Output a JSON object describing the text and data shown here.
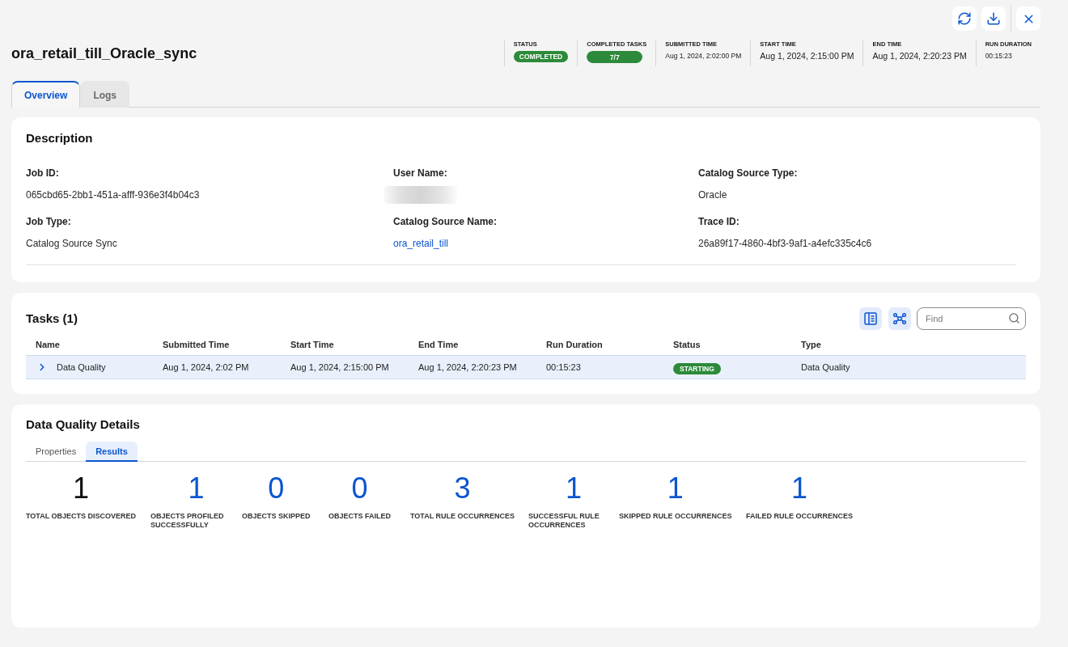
{
  "title": "ora_retail_till_Oracle_sync",
  "summary": [
    {
      "label": "STATUS",
      "kind": "badge",
      "value": "COMPLETED"
    },
    {
      "label": "COMPLETED TASKS",
      "kind": "progress",
      "value": "7/7",
      "level": 1
    },
    {
      "label": "SUBMITTED TIME",
      "kind": "text",
      "value": "Aug 1, 2024, 2:02:00 PM"
    },
    {
      "label": "START TIME",
      "kind": "text",
      "value": "Aug 1, 2024, 2:15:00 PM"
    },
    {
      "label": "END TIME",
      "kind": "text",
      "value": "Aug 1, 2024, 2:20:23 PM"
    },
    {
      "label": "RUN DURATION",
      "kind": "text",
      "value": "00:15:23"
    }
  ],
  "tabs": [
    {
      "label": "Overview",
      "selected": true
    },
    {
      "label": "Logs",
      "selected": false
    }
  ],
  "description": {
    "title": "Description",
    "fields": [
      {
        "label": "Job ID:",
        "kind": "text",
        "value": "065cbd65-2bb1-451a-afff-936e3f4b04c3"
      },
      {
        "label": "User Name:",
        "kind": "redacted"
      },
      {
        "label": "Catalog Source Type:",
        "kind": "text",
        "value": "Oracle"
      },
      {
        "label": "Job Type:",
        "kind": "text",
        "value": "Catalog Source Sync"
      },
      {
        "label": "Catalog Source Name:",
        "kind": "link",
        "value": "ora_retail_till"
      },
      {
        "label": "Trace ID:",
        "kind": "text",
        "value": "26a89f17-4860-4bf3-9af1-a4efc335c4c6"
      }
    ]
  },
  "tasks": {
    "title": "Tasks (1)",
    "search": {
      "placeholder": "Find"
    },
    "columns": [
      "Name",
      "Submitted Time",
      "Start Time",
      "End Time",
      "Run Duration",
      "Status",
      "Type"
    ],
    "rows": [
      {
        "selected": true,
        "expanded": false,
        "name": "Data Quality",
        "submitted_time": "Aug 1, 2024, 2:02 PM",
        "start_time": "Aug 1, 2024, 2:15:00 PM",
        "end_time": "Aug 1, 2024, 2:20:23 PM",
        "run_duration": "00:15:23",
        "status": "STARTING",
        "type": "Data Quality"
      }
    ]
  },
  "data_quality": {
    "title": "Data Quality Details",
    "tabs": [
      {
        "label": "Properties",
        "selected": false
      },
      {
        "label": "Results",
        "selected": true
      }
    ],
    "results": [
      {
        "value": "1",
        "label": "TOTAL OBJECTS DISCOVERED",
        "link": false
      },
      {
        "value": "1",
        "label": "OBJECTS PROFILED SUCCESSFULLY",
        "link": true
      },
      {
        "value": "0",
        "label": "OBJECTS SKIPPED",
        "link": true
      },
      {
        "value": "0",
        "label": "OBJECTS FAILED",
        "link": true
      },
      {
        "value": "3",
        "label": "TOTAL RULE OCCURRENCES",
        "link": true
      },
      {
        "value": "1",
        "label": "SUCCESSFUL RULE OCCURRENCES",
        "link": true
      },
      {
        "value": "1",
        "label": "SKIPPED RULE OCCURRENCES",
        "link": true
      },
      {
        "value": "1",
        "label": "FAILED RULE OCCURRENCES",
        "link": true
      }
    ]
  }
}
